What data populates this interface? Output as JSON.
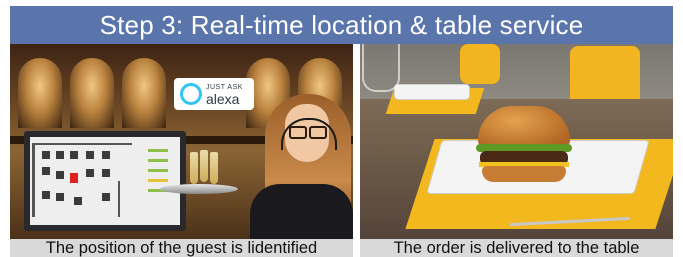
{
  "header": {
    "title": "Step 3: Real-time location & table service"
  },
  "left_panel": {
    "badge": {
      "small_text": "JUST ASK",
      "big_text": "alexa"
    },
    "caption": "The position of the guest is lidentified"
  },
  "right_panel": {
    "caption": "The order is delivered to the table"
  },
  "colors": {
    "header_bg": "#5a75ac",
    "caption_bg": "#d9d9d9",
    "alexa_ring": "#31c4f3",
    "placemat": "#f3b81d",
    "guest_marker": "#e02020"
  }
}
